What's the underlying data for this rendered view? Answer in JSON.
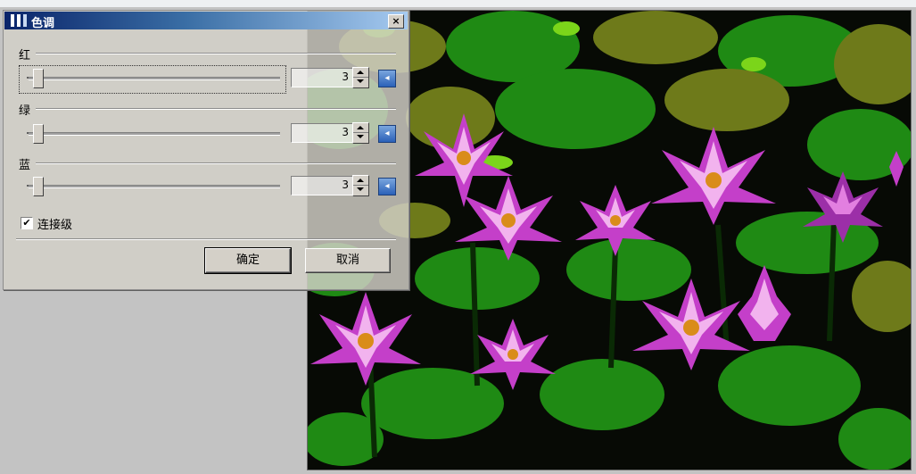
{
  "dialog": {
    "title": "色调",
    "close_label": "×",
    "channels": [
      {
        "label": "红",
        "value": "3"
      },
      {
        "label": "绿",
        "value": "3"
      },
      {
        "label": "蓝",
        "value": "3"
      }
    ],
    "link_levels_label": "连接级",
    "link_levels_checked": true,
    "check_mark": "✔",
    "ok_label": "确定",
    "cancel_label": "取消",
    "reset_glyph": "◂"
  },
  "colors": {
    "title_bar_start": "#0a246a",
    "title_bar_end": "#a6caf0",
    "lily_pad_green": "#1f8a14",
    "lily_pad_olive": "#6e7a1a",
    "lily_pad_lime": "#7bd51a",
    "petal_magenta": "#c43fc9",
    "petal_pink": "#f2b3ee",
    "flower_center": "#d98c1a"
  }
}
